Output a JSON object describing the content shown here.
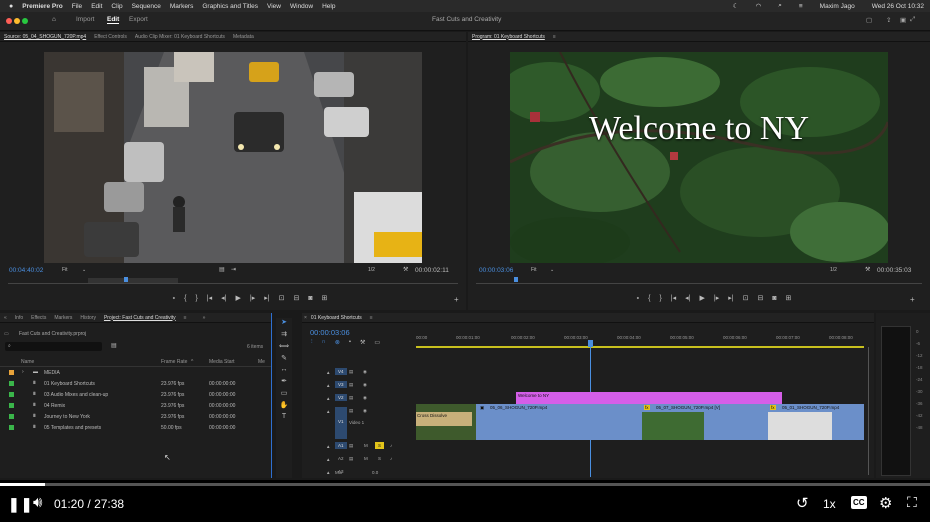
{
  "menubar": {
    "apple": "",
    "app": "Premiere Pro",
    "items": [
      "File",
      "Edit",
      "Clip",
      "Sequence",
      "Markers",
      "Graphics and Titles",
      "View",
      "Window",
      "Help"
    ],
    "user": "Maxim Jago",
    "date": "Wed 26 Oct  10:32"
  },
  "app_header": {
    "tabs": [
      "Import",
      "Edit",
      "Export"
    ],
    "active_tab": "Edit",
    "project_title": "Fast Cuts and Creativity"
  },
  "source_panel": {
    "tabs": [
      "Source: 05_04_SHOGUN_720P.mp4",
      "Effect Controls",
      "Audio Clip Mixer: 01 Keyboard Shortcuts",
      "Metadata"
    ],
    "timecode": "00:04:40:02",
    "zoom": "Fit",
    "scale": "1/2",
    "duration": "00:00:02:11"
  },
  "program_panel": {
    "tab": "Program: 01 Keyboard Shortcuts",
    "title_overlay": "Welcome to NY",
    "timecode": "00:00:03:06",
    "zoom": "Fit",
    "scale": "1/2",
    "duration": "00:00:35:03"
  },
  "project_panel": {
    "tabs": [
      "Info",
      "Effects",
      "Markers",
      "History",
      "Project: Fast Cuts and Creativity"
    ],
    "file": "Fast Cuts and Creativity.prproj",
    "item_count": "6 items",
    "columns": [
      "Name",
      "Frame Rate",
      "Media Start",
      "Me"
    ],
    "rows": [
      {
        "name": "MEDIA",
        "rate": "",
        "start": "",
        "color": "#e8a33a",
        "folder": true
      },
      {
        "name": "01 Keyboard Shortcuts",
        "rate": "23.976 fps",
        "start": "00:00:00:00",
        "color": "#3ab54a",
        "folder": false
      },
      {
        "name": "03 Audio Mixes and clean-up",
        "rate": "23.976 fps",
        "start": "00:00:00:00",
        "color": "#3ab54a",
        "folder": false
      },
      {
        "name": "04 Remix",
        "rate": "23.976 fps",
        "start": "00:00:00:00",
        "color": "#3ab54a",
        "folder": false
      },
      {
        "name": "Journey to New York",
        "rate": "23.976 fps",
        "start": "00:00:00:00",
        "color": "#3ab54a",
        "folder": false
      },
      {
        "name": "05 Templates and presets",
        "rate": "50.00 fps",
        "start": "00:00:00:00",
        "color": "#3ab54a",
        "folder": false
      }
    ]
  },
  "timeline": {
    "tab": "01 Keyboard Shortcuts",
    "timecode": "00:00:03:06",
    "ruler": [
      "00:00",
      "00:00:01:00",
      "00:00:02:00",
      "00:00:03:00",
      "00:00:04:00",
      "00:00:05:00",
      "00:00:06:00",
      "00:00:07:00",
      "00:00:08:00"
    ],
    "tracks": [
      "V4",
      "V3",
      "V2",
      "V1",
      "A1",
      "A2",
      "A3"
    ],
    "v1_label": "Video 1",
    "mix_label": "Mix",
    "mix_value": "0.0",
    "clips": {
      "title": "Welcome to NY",
      "dissolve": "Cross Dissolve",
      "c1": "05_06_SHOGUN_720P.mp4",
      "c2": "05_07_SHOGUN_720P.mp4 [V]",
      "c3": "05_01_SHOGUN_720P.mp4"
    },
    "meter_labels": [
      "0",
      "-6",
      "-12",
      "-18",
      "-24",
      "-30",
      "-36",
      "-42",
      "-48"
    ]
  },
  "video_player": {
    "current": "01:20",
    "total": "27:38",
    "separator": "/",
    "speed": "1x",
    "cc": "CC",
    "progress": 0.0482
  }
}
